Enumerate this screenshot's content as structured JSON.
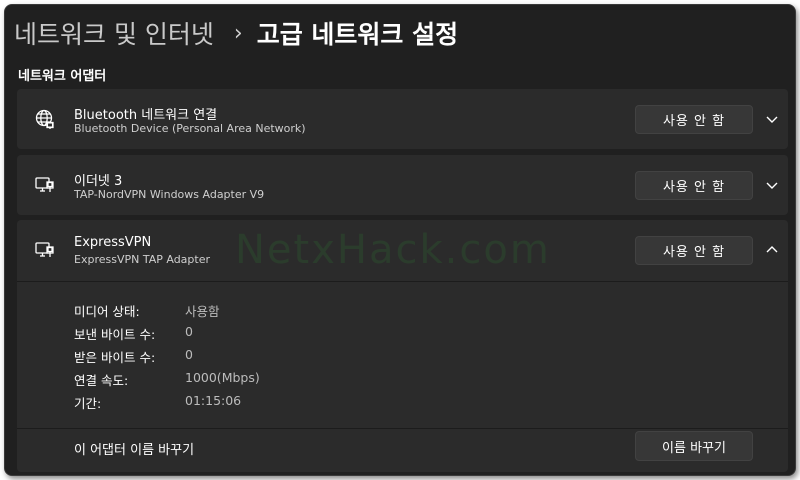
{
  "breadcrumb": {
    "parent": "네트워크 및 인터넷",
    "separator": "›",
    "current": "고급 네트워크 설정"
  },
  "section": {
    "title": "네트워크 어댑터"
  },
  "adapters": [
    {
      "name": "Bluetooth 네트워크 연결",
      "description": "Bluetooth Device (Personal Area Network)",
      "icon": "globe-network-icon",
      "button_label": "사용 안 함",
      "expanded": false
    },
    {
      "name": "이더넷 3",
      "description": "TAP-NordVPN Windows Adapter V9",
      "icon": "ethernet-monitor-icon",
      "button_label": "사용 안 함",
      "expanded": false
    },
    {
      "name": "ExpressVPN",
      "description": "ExpressVPN TAP Adapter",
      "icon": "ethernet-monitor-icon",
      "button_label": "사용 안 함",
      "expanded": true
    }
  ],
  "details": {
    "media_state_label": "미디어 상태:",
    "media_state_value": "사용함",
    "bytes_sent_label": "보낸 바이트 수:",
    "bytes_sent_value": "0",
    "bytes_received_label": "받은 바이트 수:",
    "bytes_received_value": "0",
    "link_speed_label": "연결 속도:",
    "link_speed_value": "1000(Mbps)",
    "duration_label": "기간:",
    "duration_value": "01:15:06"
  },
  "rename": {
    "label": "이 어댑터 이름 바꾸기",
    "button_label": "이름 바꾸기"
  },
  "watermark": "NetxHack.com",
  "colors": {
    "window_bg": "#202020",
    "card_bg": "#2b2b2b",
    "button_bg": "#373737",
    "text_primary": "#ffffff",
    "text_secondary": "#cfcfcf"
  }
}
